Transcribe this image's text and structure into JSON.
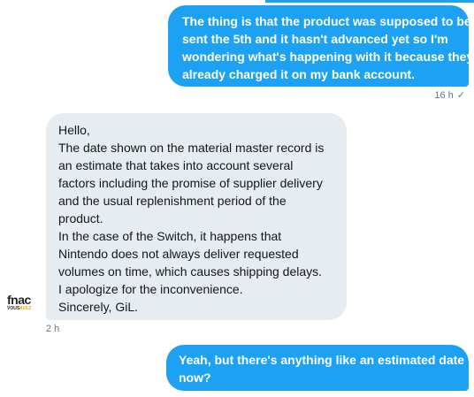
{
  "conversation": {
    "messages": [
      {
        "direction": "outgoing",
        "lines": [
          "The thing is that the product was supposed to be",
          "sent the 5th and it hasn't advanced yet so I'm",
          "wondering what's happening with it because they",
          "already charged it on my bank account."
        ],
        "timestamp": "16 h",
        "status_icon": "read-check-icon",
        "status_glyph": "✓"
      },
      {
        "direction": "incoming",
        "lines": [
          "Hello,",
          "The date shown on the material master record is",
          "an estimate that takes into account several",
          "factors including the promise of supplier delivery",
          "and the usual replenishment period of the",
          "product.",
          "In the case of the Switch, it happens that",
          "Nintendo does not always deliver requested",
          "volumes on time, which causes shipping delays.",
          "I apologize for the inconvenience.",
          "Sincerely, GiL."
        ],
        "timestamp": "2 h",
        "sender_avatar": {
          "brand": "fnac",
          "tagline_prefix": "VOUS",
          "tagline_highlight": "AVEZ"
        }
      },
      {
        "direction": "outgoing",
        "lines": [
          "Yeah, but there's anything like an estimated date",
          "now?"
        ]
      }
    ]
  },
  "colors": {
    "outgoing_bubble": "#1da1f2",
    "incoming_bubble": "#e6ecf0",
    "timestamp_text": "#657786",
    "avatar_highlight": "#f2a900"
  }
}
